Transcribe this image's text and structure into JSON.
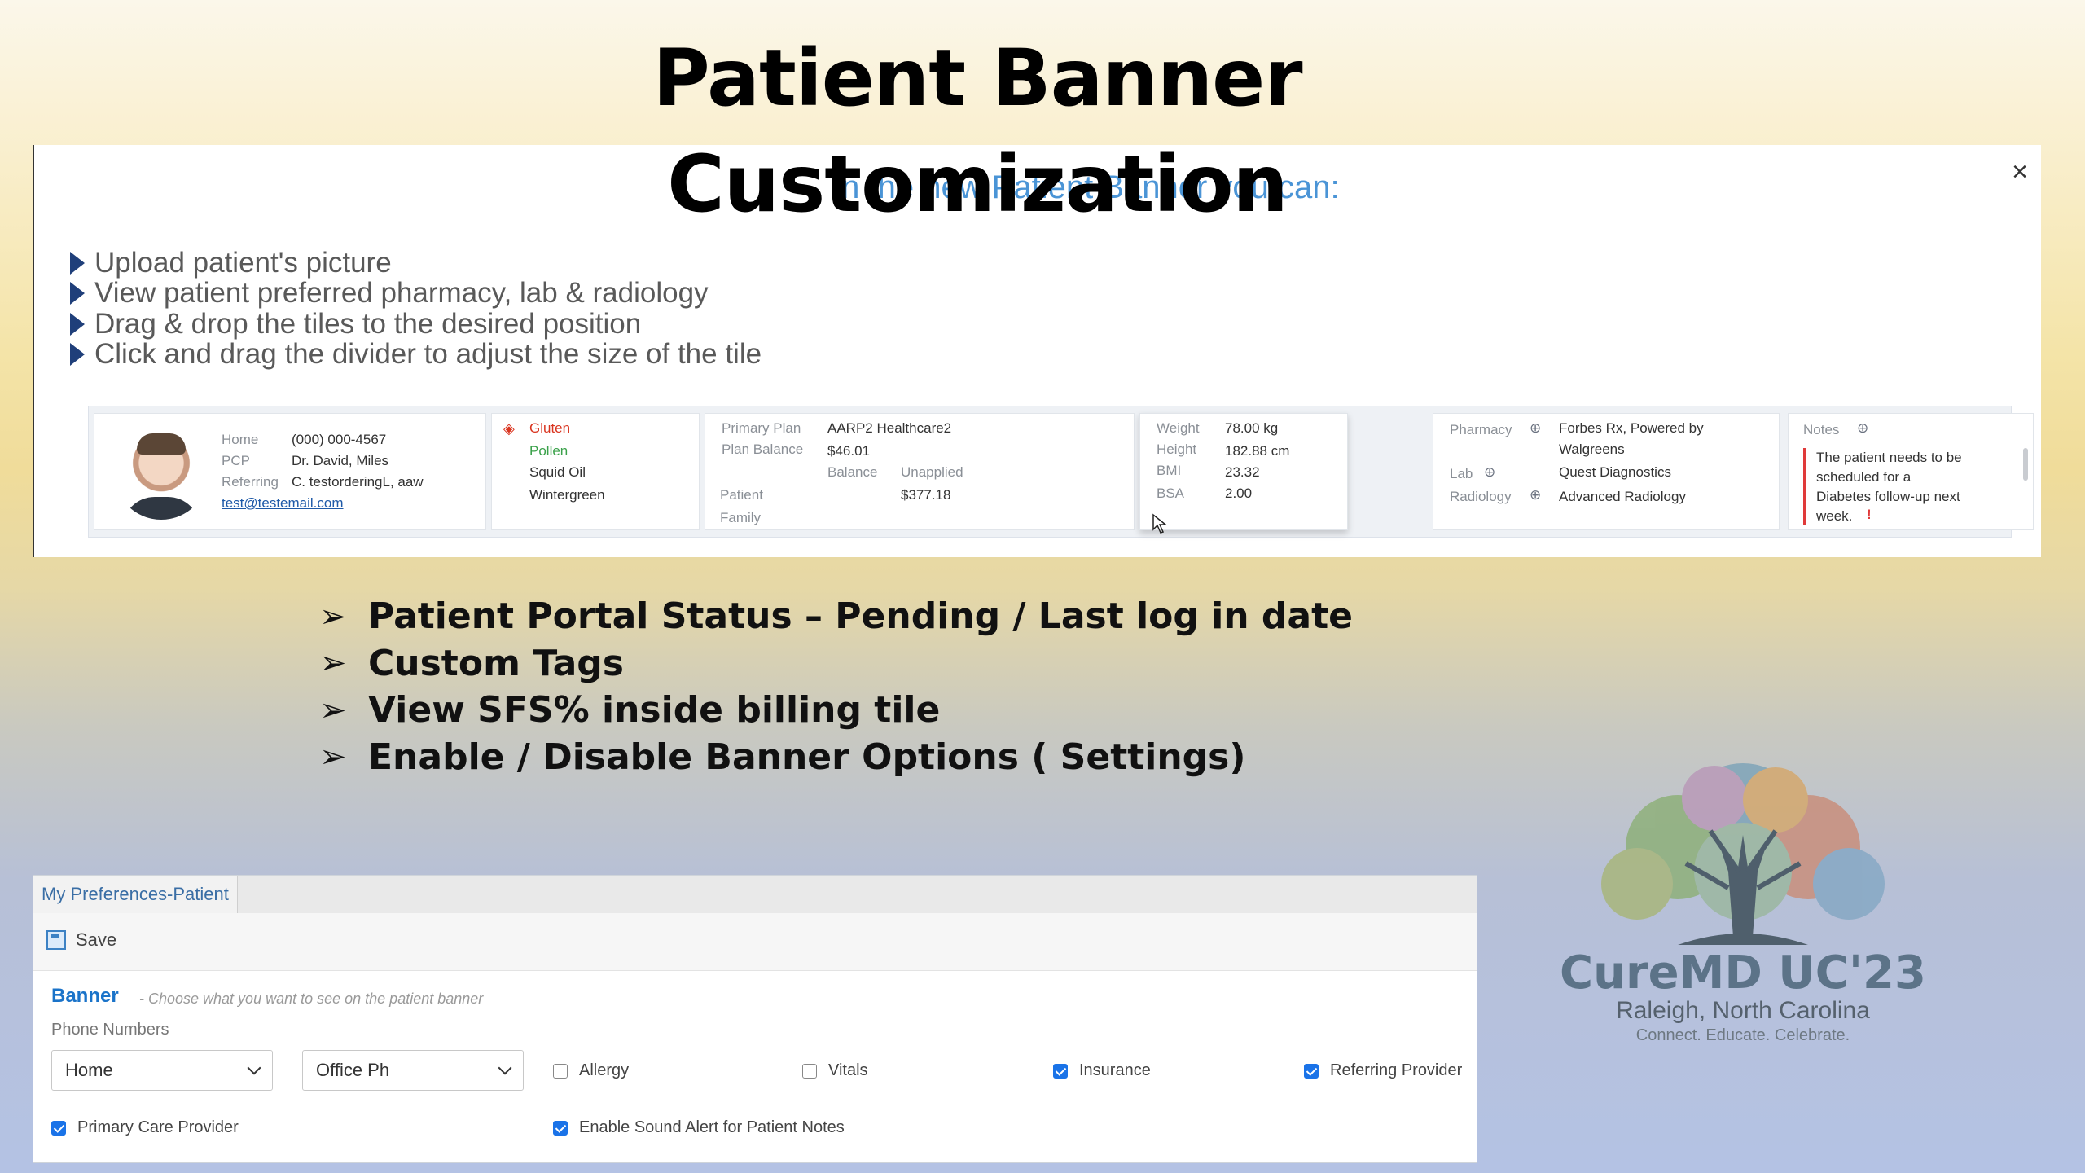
{
  "slide": {
    "title_line1": "Patient Banner",
    "title_line2": "Customization"
  },
  "intro_panel": {
    "heading": "In the new Patient Banner you can:",
    "close_symbol": "×",
    "bullets": [
      "Upload patient's picture",
      "View patient preferred pharmacy, lab & radiology",
      "Drag & drop the tiles to the desired position",
      "Click and drag the divider to adjust the size of the tile"
    ]
  },
  "patient_banner": {
    "contact": {
      "home_label": "Home",
      "home_value": "(000) 000-4567",
      "pcp_label": "PCP",
      "pcp_value": "Dr. David, Miles",
      "referring_label": "Referring",
      "referring_value": "C. testorderingL, aaw",
      "email": "test@testemail.com"
    },
    "allergies": [
      "Gluten",
      "Pollen",
      "Squid Oil",
      "Wintergreen"
    ],
    "insurance": {
      "primary_plan_label": "Primary Plan",
      "primary_plan_value": "AARP2 Healthcare2",
      "plan_balance_label": "Plan Balance",
      "plan_balance_value": "$46.01",
      "balance_header": "Balance",
      "unapplied_header": "Unapplied",
      "patient_label": "Patient",
      "patient_unapplied": "$377.18",
      "family_label": "Family"
    },
    "vitals": {
      "weight_label": "Weight",
      "weight_value": "78.00 kg",
      "height_label": "Height",
      "height_value": "182.88 cm",
      "bmi_label": "BMI",
      "bmi_value": "23.32",
      "bsa_label": "BSA",
      "bsa_value": "2.00"
    },
    "providers": {
      "pharmacy_label": "Pharmacy",
      "pharmacy_value_line1": "Forbes Rx, Powered by",
      "pharmacy_value_line2": "Walgreens",
      "lab_label": "Lab",
      "lab_value": "Quest Diagnostics",
      "radiology_label": "Radiology",
      "radiology_value": "Advanced Radiology"
    },
    "notes": {
      "label": "Notes",
      "line1": "The patient needs to be",
      "line2": "scheduled for a",
      "line3": "Diabetes follow-up next",
      "line4": "week.",
      "alert": "!"
    }
  },
  "features": [
    "Patient Portal Status – Pending / Last log in date",
    "Custom Tags",
    "View SFS% inside billing tile",
    "Enable / Disable Banner Options ( Settings)"
  ],
  "preferences": {
    "tab_label": "My Preferences-Patient",
    "save_label": "Save",
    "section_title": "Banner",
    "section_desc": "- Choose what you want to see on the patient banner",
    "phone_label": "Phone Numbers",
    "phone_select_1": "Home",
    "phone_select_2": "Office Ph",
    "checkboxes": {
      "allergy": {
        "label": "Allergy",
        "checked": false
      },
      "vitals": {
        "label": "Vitals",
        "checked": false
      },
      "insurance": {
        "label": "Insurance",
        "checked": true
      },
      "referring_provider": {
        "label": "Referring Provider",
        "checked": true
      },
      "primary_care_provider": {
        "label": "Primary Care Provider",
        "checked": true
      },
      "sound_alert": {
        "label": "Enable Sound Alert for Patient Notes",
        "checked": true
      }
    }
  },
  "logo": {
    "name": "CureMD UC'23",
    "place": "Raleigh, North Carolina",
    "tagline": "Connect. Educate. Celebrate."
  },
  "colors": {
    "accent_blue": "#1a73c9",
    "allergy_red": "#d9341f",
    "allergy_green": "#3aa14a",
    "bullet_arrow": "#1f3f7a"
  }
}
